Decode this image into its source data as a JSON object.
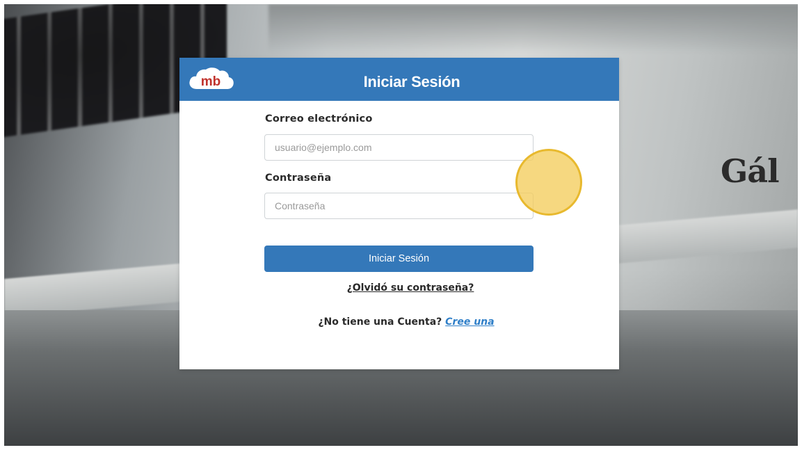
{
  "header": {
    "logo_text": "mb",
    "title": "Iniciar Sesión"
  },
  "form": {
    "email_label": "Correo electrónico",
    "email_placeholder": "usuario@ejemplo.com",
    "email_value": "",
    "password_label": "Contraseña",
    "password_placeholder": "Contraseña",
    "password_value": "",
    "submit_label": "Iniciar Sesión",
    "forgot_link": "¿Olvidó su contraseña?",
    "signup_prompt": "¿No tiene una Cuenta?",
    "signup_link": "Cree una"
  },
  "background": {
    "brand_text": "Gál"
  },
  "colors": {
    "primary": "#3478b9",
    "link": "#2f7fc8",
    "logo_red": "#c0322c",
    "cursor_highlight": "#f3cd5c"
  }
}
